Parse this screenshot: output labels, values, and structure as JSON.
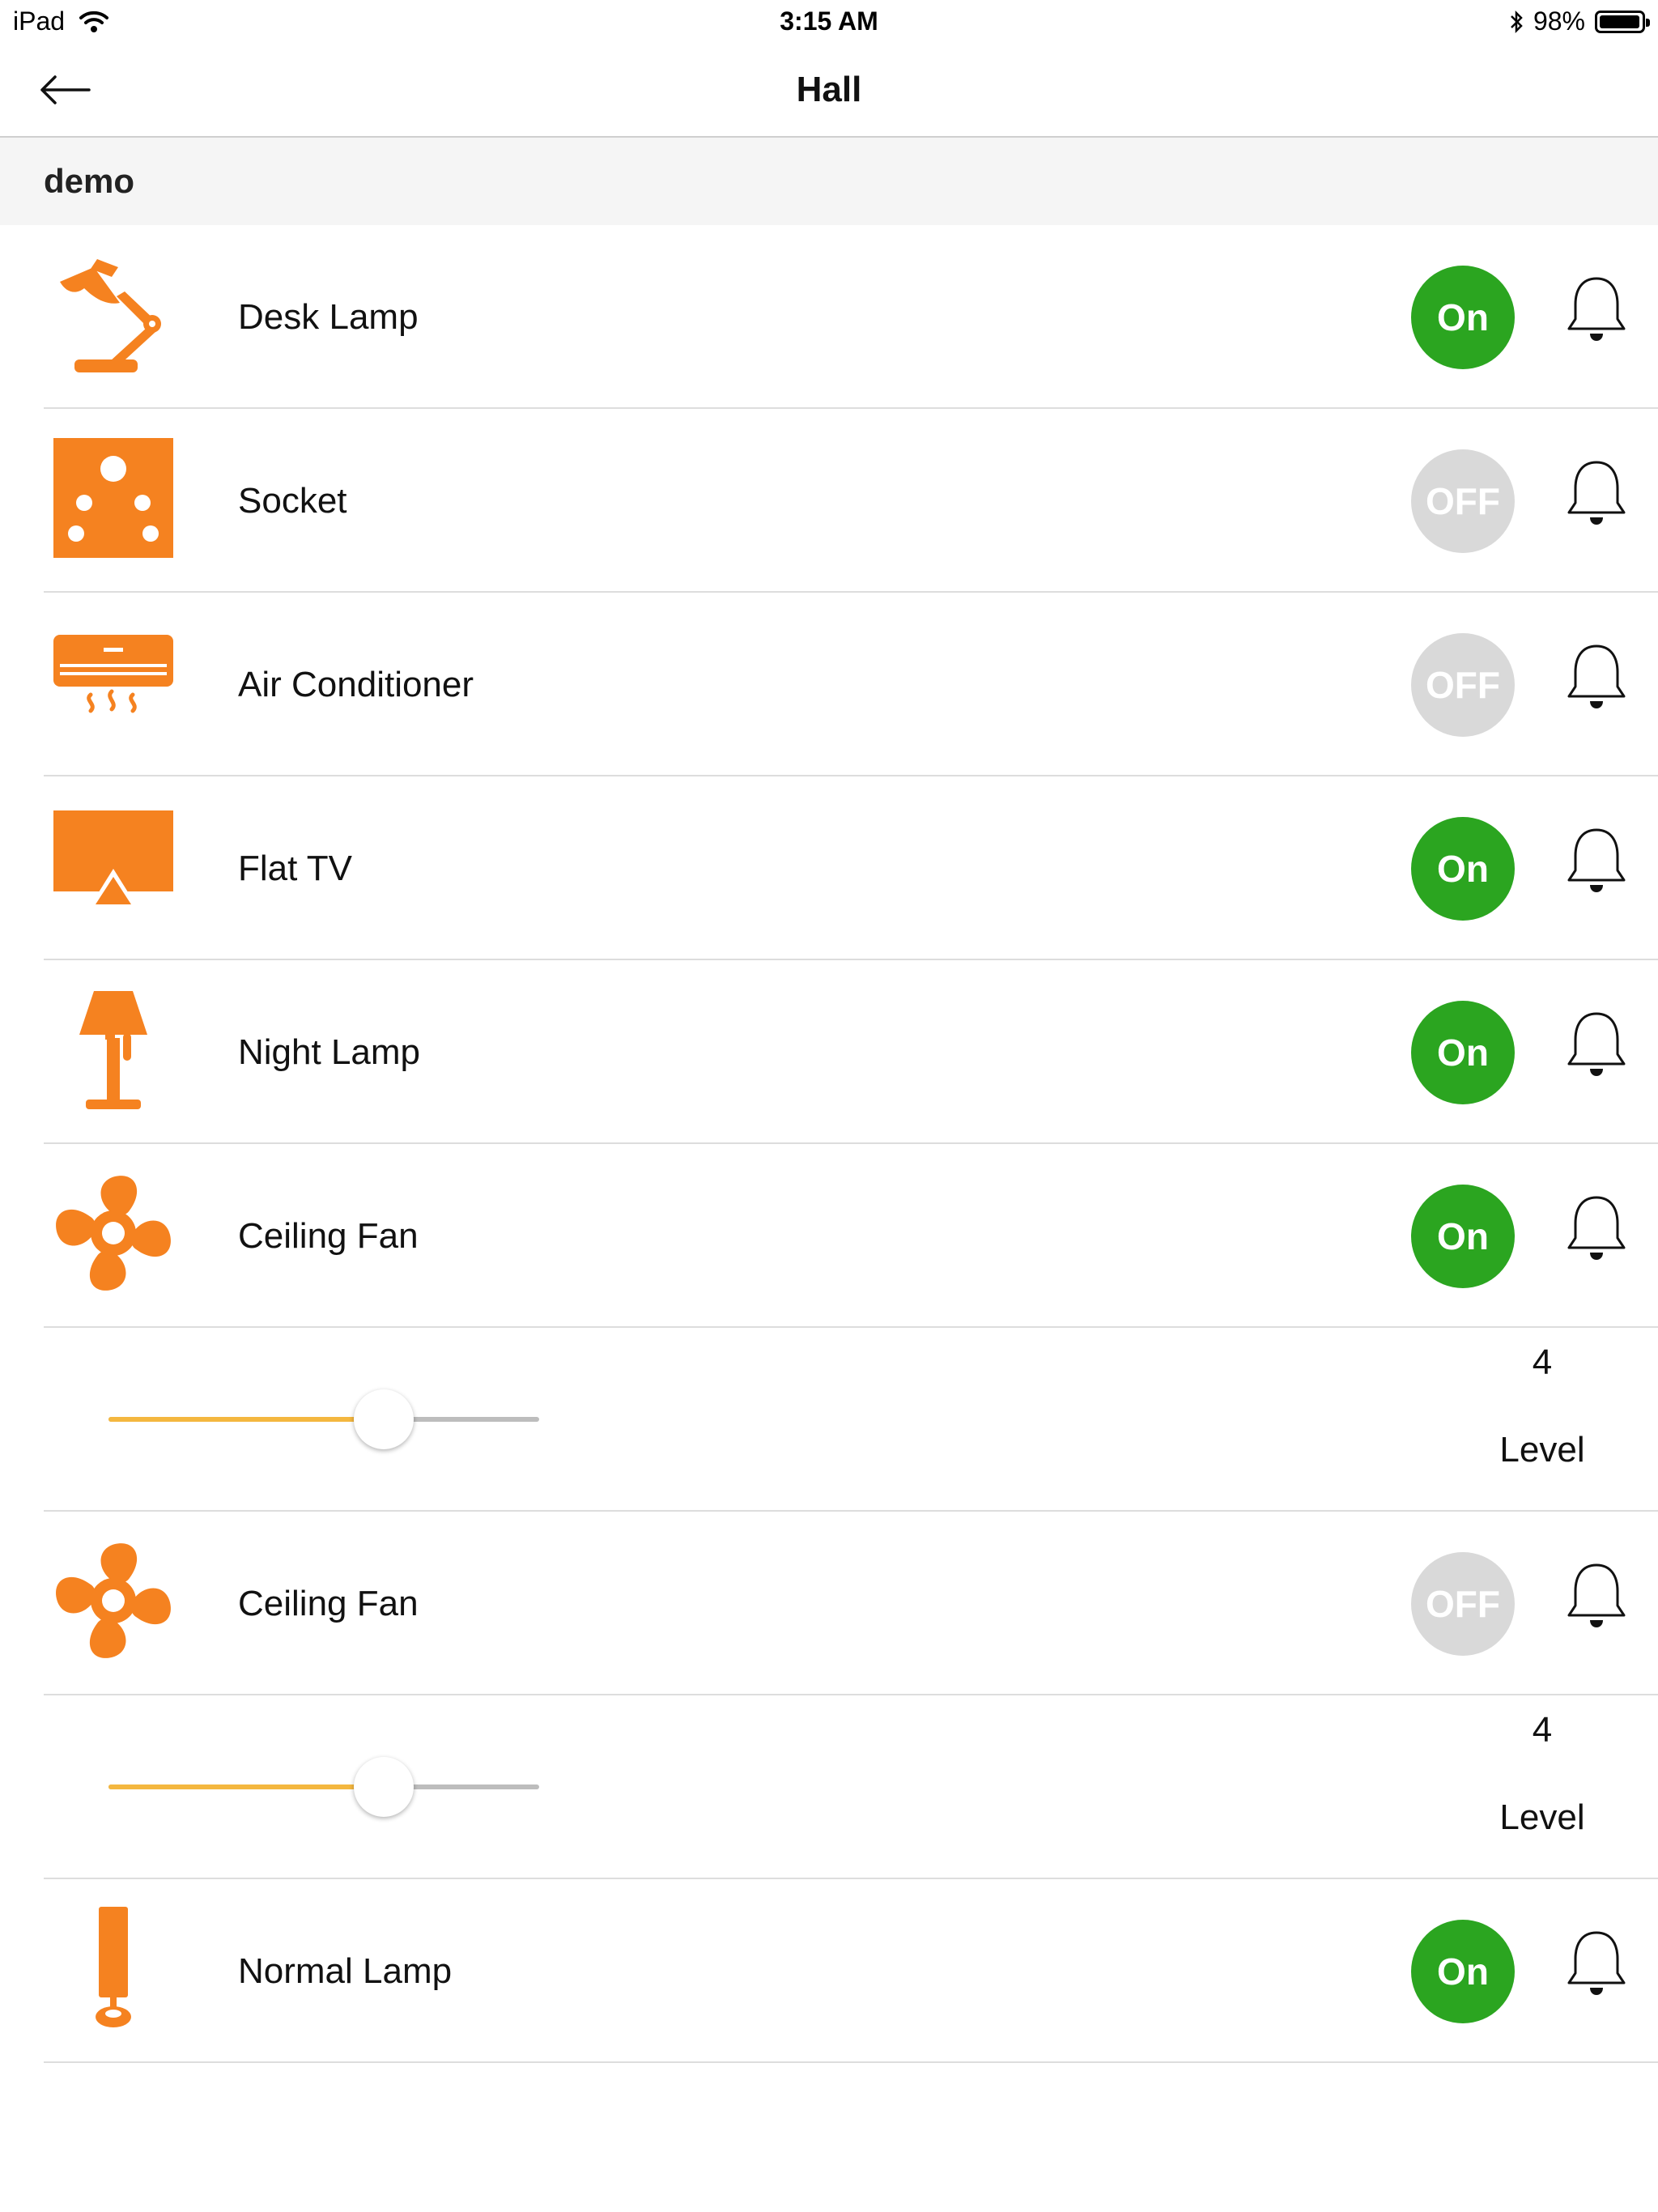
{
  "status_bar": {
    "device": "iPad",
    "time": "3:15 AM",
    "battery": "98%",
    "battery_level": 0.98
  },
  "nav": {
    "title": "Hall",
    "back_icon": "arrow-left-icon"
  },
  "section": {
    "name": "demo"
  },
  "colors": {
    "accent": "#f58220",
    "on": "#2ba520",
    "off": "#d9d9d9",
    "slider": "#f4b73f"
  },
  "devices": [
    {
      "label": "Desk Lamp",
      "icon": "desk-lamp-icon",
      "state": "On"
    },
    {
      "label": "Socket",
      "icon": "socket-icon",
      "state": "OFF"
    },
    {
      "label": "Air Conditioner",
      "icon": "air-conditioner-icon",
      "state": "OFF"
    },
    {
      "label": "Flat TV",
      "icon": "flat-tv-icon",
      "state": "On"
    },
    {
      "label": "Night Lamp",
      "icon": "night-lamp-icon",
      "state": "On"
    },
    {
      "label": "Ceiling Fan",
      "icon": "ceiling-fan-icon",
      "state": "On",
      "level": {
        "value": "4",
        "label": "Level",
        "fraction": 0.64
      }
    },
    {
      "label": "Ceiling Fan",
      "icon": "ceiling-fan-icon",
      "state": "OFF",
      "level": {
        "value": "4",
        "label": "Level",
        "fraction": 0.64
      }
    },
    {
      "label": "Normal Lamp",
      "icon": "normal-lamp-icon",
      "state": "On"
    }
  ]
}
